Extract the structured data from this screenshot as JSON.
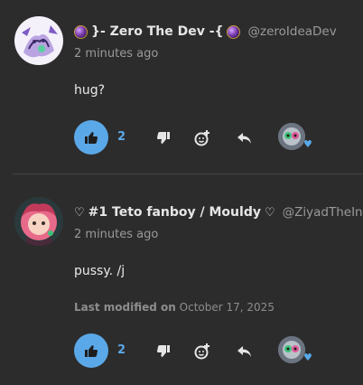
{
  "posts": [
    {
      "author": "}- Zero The Dev -{",
      "handle": "@zeroIdeaDev",
      "time": "2 minutes ago",
      "content": "hug?",
      "likes": "2",
      "modified_label": "",
      "modified_date": ""
    },
    {
      "author": "#1 Teto fanboy / Mouldy",
      "handle": "@ZiyadTheIns",
      "time": "2 minutes ago",
      "content": "pussy. /j",
      "likes": "2",
      "modified_label": "Last modified on",
      "modified_date": "October 17, 2025"
    }
  ],
  "colors": {
    "background": "#2d2c2c",
    "accent": "#5aa8e8",
    "muted": "#9a9a9a"
  },
  "icons": {
    "like": "thumbs-up-icon",
    "dislike": "thumbs-down-icon",
    "react": "add-reaction-icon",
    "reply": "reply-icon",
    "reactor_heart": "heart-icon"
  }
}
